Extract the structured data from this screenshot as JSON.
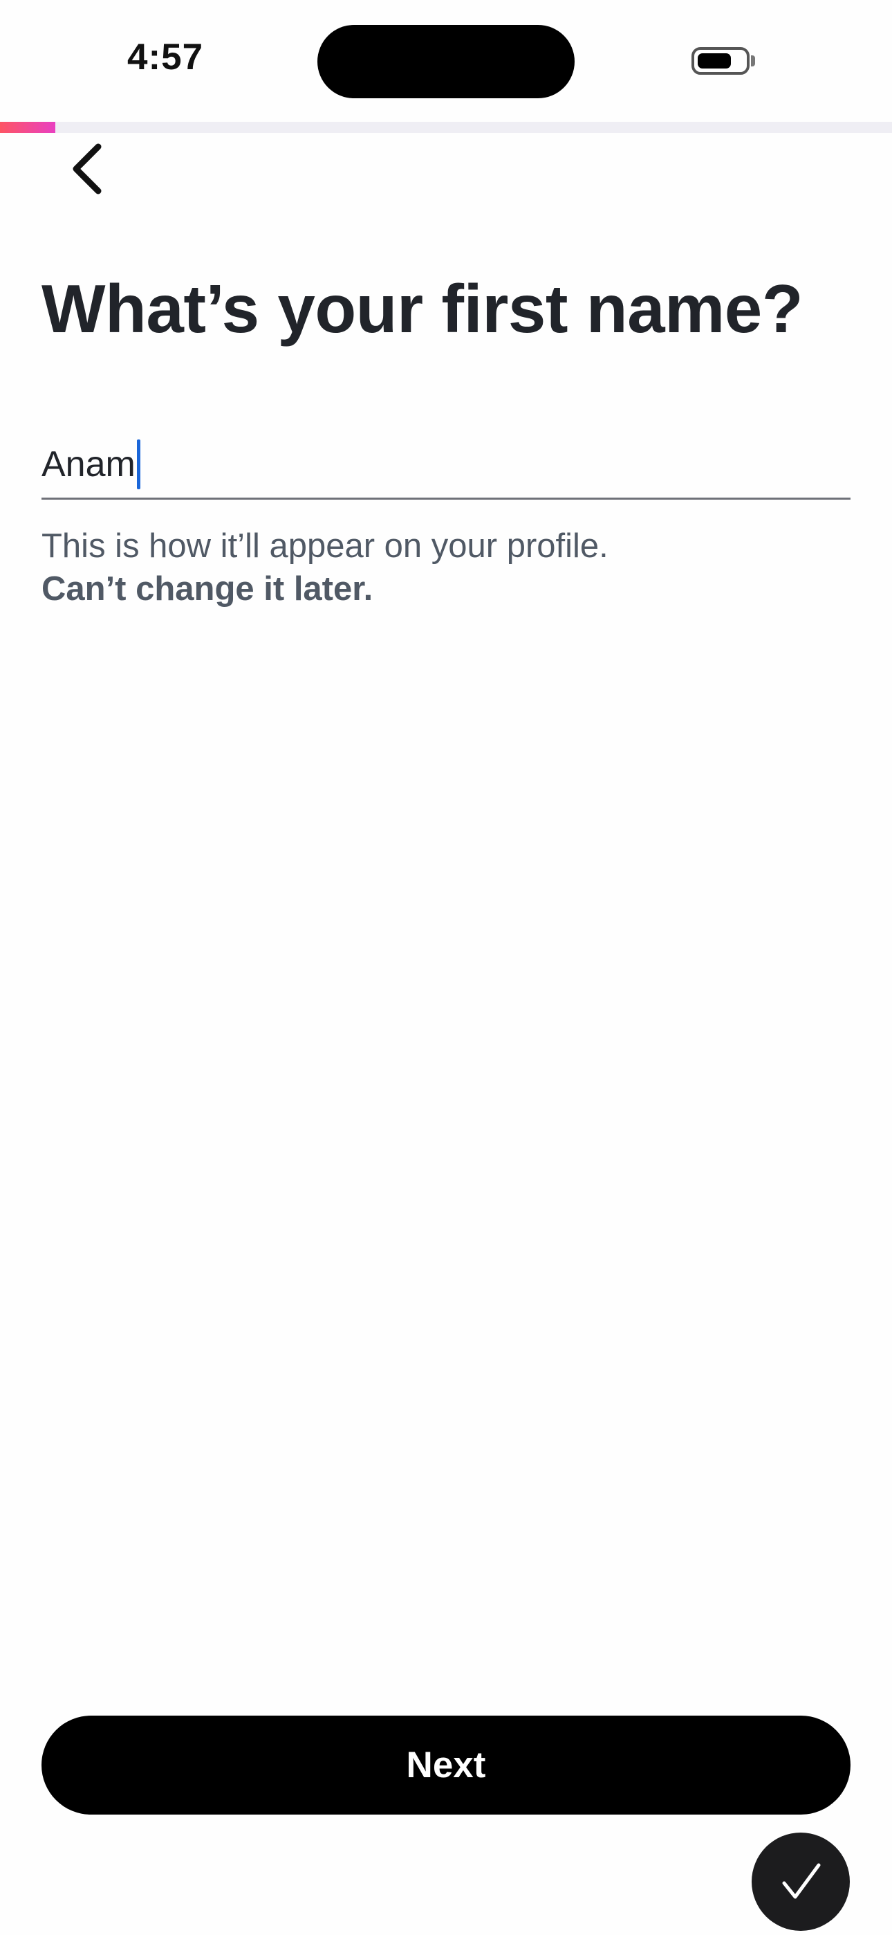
{
  "status_bar": {
    "time": "4:57",
    "battery_level": 0.72
  },
  "progress": {
    "fraction": 0.062,
    "colors": [
      "#fd5564",
      "#e940c1"
    ]
  },
  "header": {
    "back_icon": "chevron-left-icon"
  },
  "main": {
    "title": "What’s your first name?",
    "name_input": {
      "value": "Anam",
      "caret_color": "#1a66d9"
    },
    "helper_text": "This is how it’ll appear on your profile.",
    "helper_note": "Can’t change it later."
  },
  "footer": {
    "next_label": "Next",
    "done_icon": "checkmark-icon"
  }
}
